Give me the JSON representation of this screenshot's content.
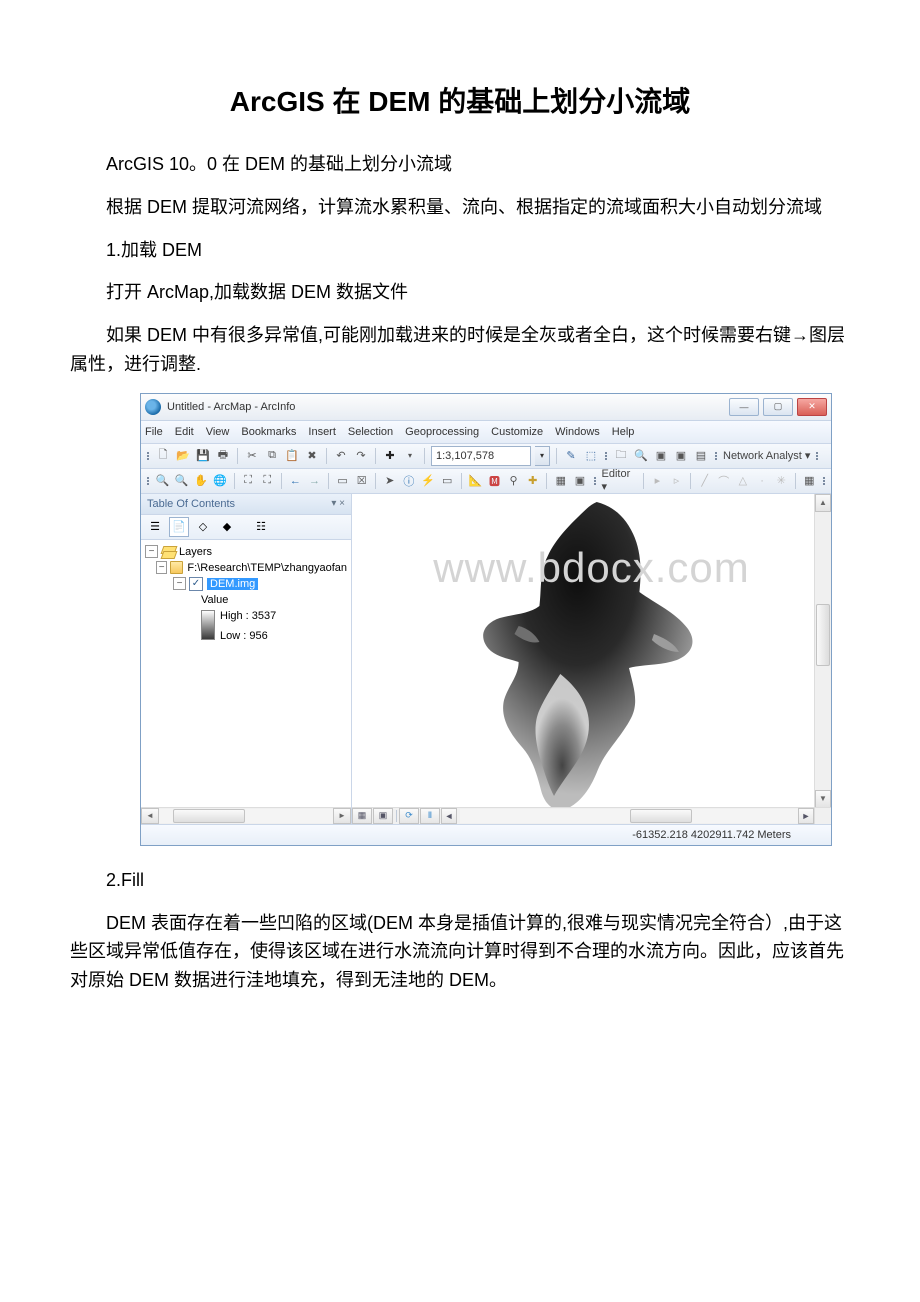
{
  "article": {
    "title": "ArcGIS 在 DEM 的基础上划分小流域",
    "p1": "ArcGIS 10。0 在 DEM 的基础上划分小流域",
    "p2": "根据 DEM 提取河流网络，计算流水累积量、流向、根据指定的流域面积大小自动划分流域",
    "p3": "1.加载 DEM",
    "p4": "打开 ArcMap,加载数据 DEM 数据文件",
    "p5": "如果 DEM 中有很多异常值,可能刚加载进来的时候是全灰或者全白，这个时候需要右键→图层属性，进行调整.",
    "p6": "2.Fill",
    "p7": "DEM 表面存在着一些凹陷的区域(DEM 本身是插值计算的,很难与现实情况完全符合）,由于这些区域异常低值存在，使得该区域在进行水流流向计算时得到不合理的水流方向。因此，应该首先对原始 DEM 数据进行洼地填充，得到无洼地的 DEM。"
  },
  "window": {
    "title": "Untitled - ArcMap - ArcInfo"
  },
  "menus": [
    "File",
    "Edit",
    "View",
    "Bookmarks",
    "Insert",
    "Selection",
    "Geoprocessing",
    "Customize",
    "Windows",
    "Help"
  ],
  "toolbar1": {
    "scale": "1:3,107,578",
    "na_label": "Network Analyst ▾"
  },
  "toolbar2": {
    "editor_label": "Editor ▾"
  },
  "toc": {
    "title": "Table Of Contents",
    "pin": "▾ ×",
    "layers_label": "Layers",
    "folder_path": "F:\\Research\\TEMP\\zhangyaofan",
    "layer_name": "DEM.img",
    "value_label": "Value",
    "high_label": "High : 3537",
    "low_label": "Low : 956"
  },
  "map": {
    "watermark": "www.bdocx.com"
  },
  "status": {
    "coords": "-61352.218 4202911.742 Meters"
  }
}
